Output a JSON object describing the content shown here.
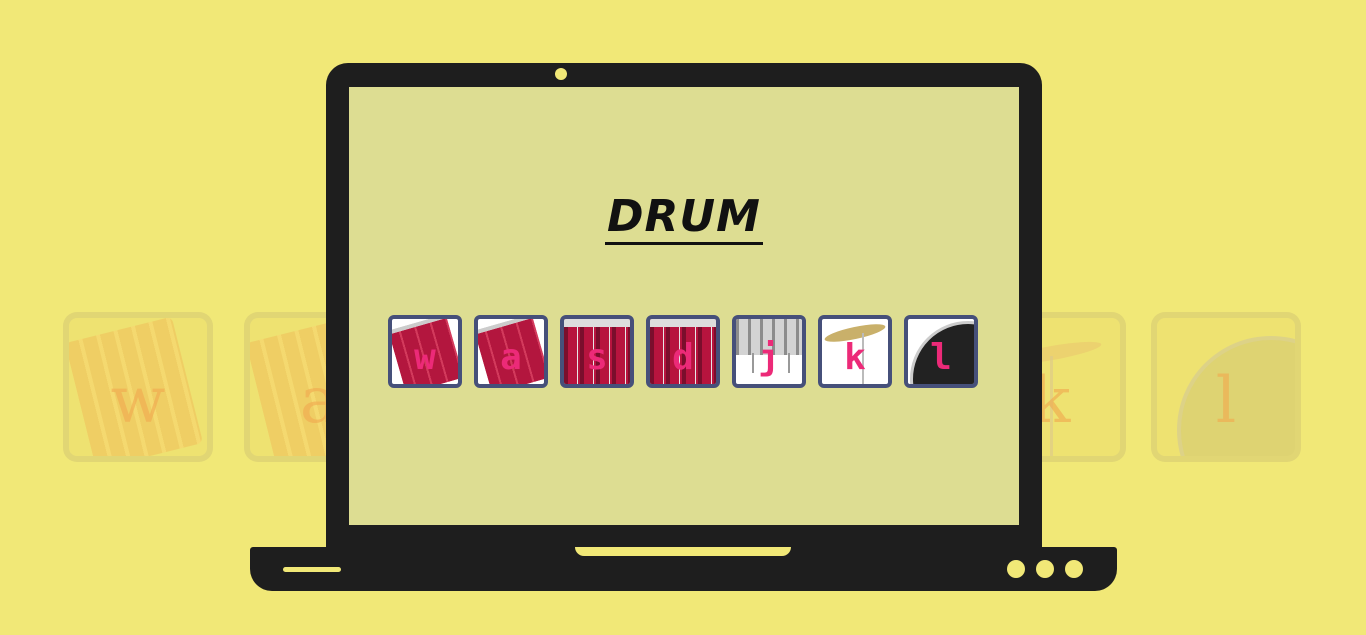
{
  "title": "DRUM",
  "keys": [
    {
      "letter": "w",
      "icon": "tom-drum-icon"
    },
    {
      "letter": "a",
      "icon": "tom-drum-icon"
    },
    {
      "letter": "s",
      "icon": "floor-tom-icon"
    },
    {
      "letter": "d",
      "icon": "floor-tom-icon"
    },
    {
      "letter": "j",
      "icon": "snare-drum-icon"
    },
    {
      "letter": "k",
      "icon": "cymbal-icon"
    },
    {
      "letter": "l",
      "icon": "bass-drum-icon"
    }
  ],
  "background_tiles": [
    {
      "letter": "w"
    },
    {
      "letter": "a"
    },
    {
      "letter": "k"
    },
    {
      "letter": "l"
    }
  ],
  "colors": {
    "page_background": "#f1e877",
    "screen_background": "#dddd92",
    "laptop_body": "#1e1e1e",
    "tile_border": "#46507a",
    "key_letter": "#ec2a78"
  }
}
